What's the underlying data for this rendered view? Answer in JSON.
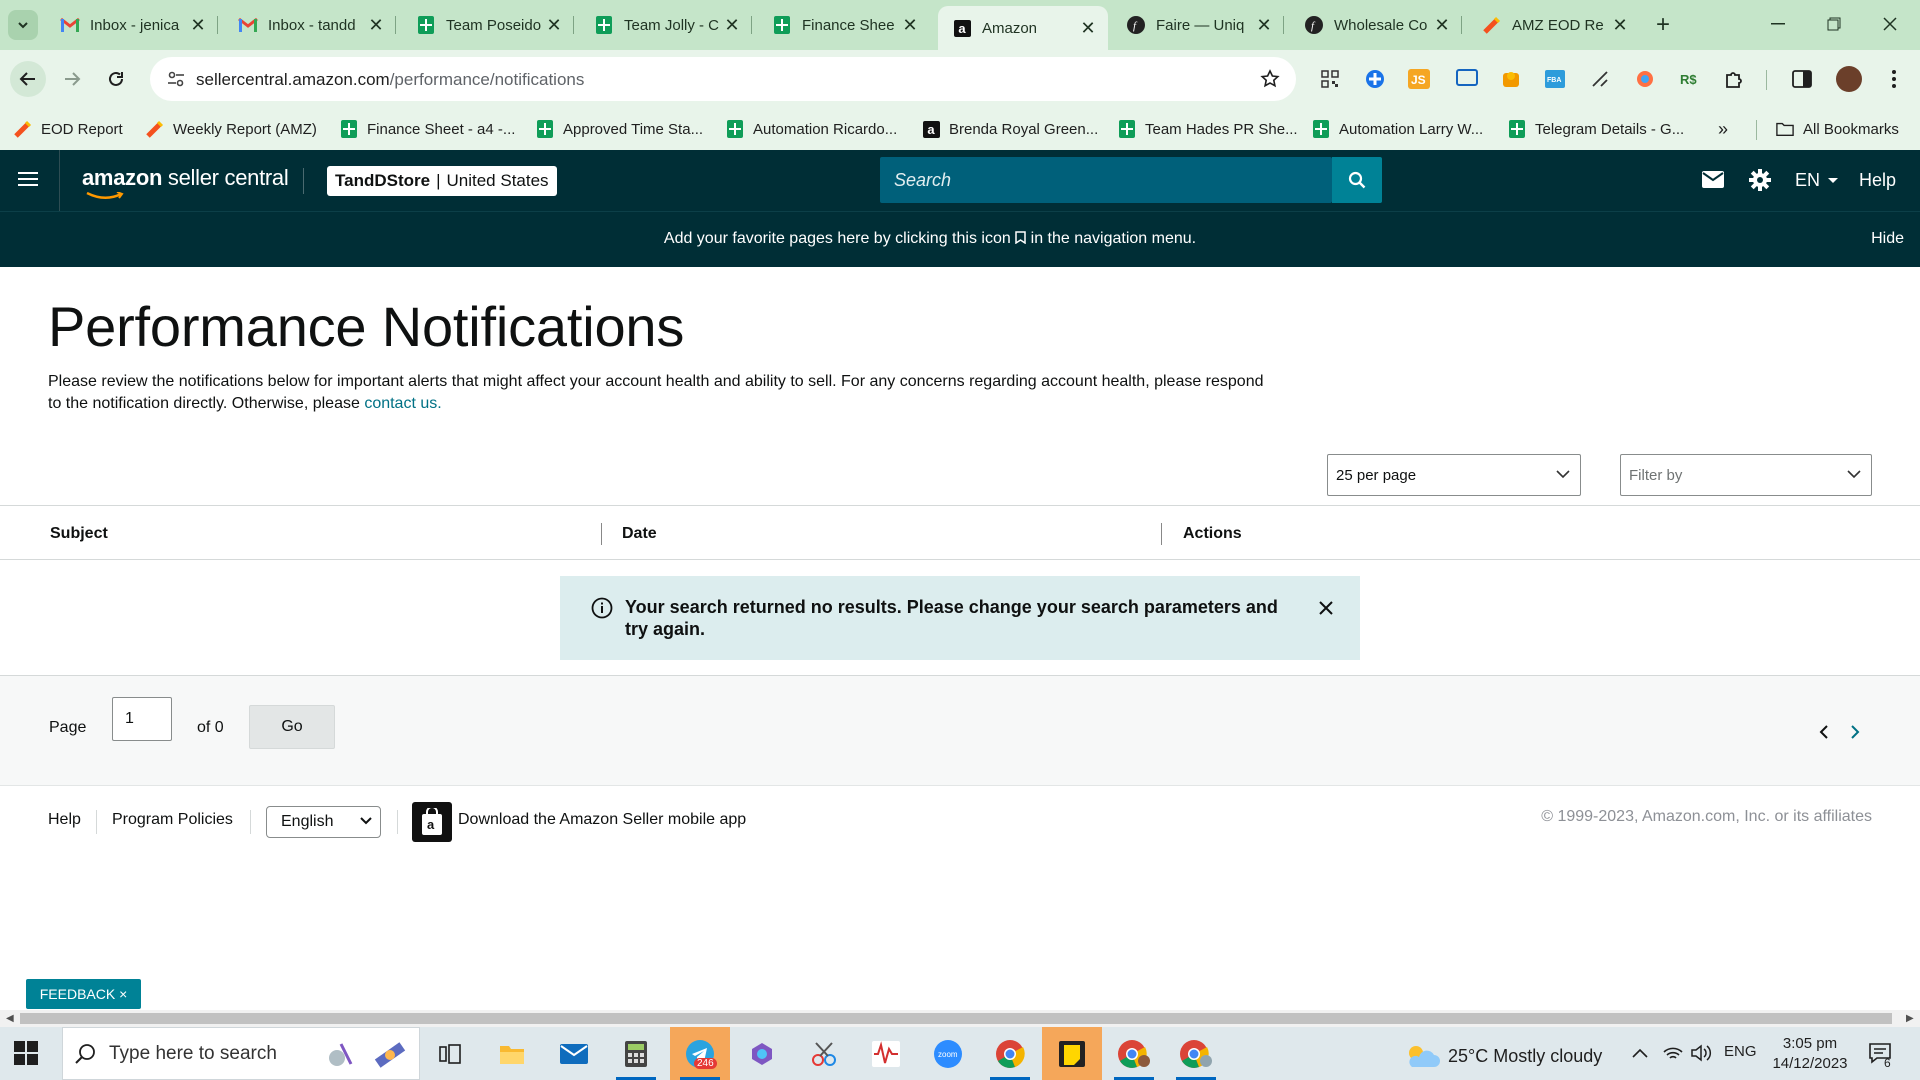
{
  "browser": {
    "tabs": [
      {
        "title": "Inbox - jenica",
        "icon": "gmail-icon"
      },
      {
        "title": "Inbox - tandd",
        "icon": "gmail-icon"
      },
      {
        "title": "Team Poseido",
        "icon": "sheets-icon"
      },
      {
        "title": "Team Jolly - C",
        "icon": "sheets-icon"
      },
      {
        "title": "Finance Shee",
        "icon": "sheets-icon"
      },
      {
        "title": "Amazon",
        "icon": "amazon-icon",
        "active": true
      },
      {
        "title": "Faire — Uniq",
        "icon": "faire-icon"
      },
      {
        "title": "Wholesale Co",
        "icon": "faire-icon"
      },
      {
        "title": "AMZ EOD Re",
        "icon": "pencil-icon"
      }
    ],
    "url_domain": "sellercentral.amazon.com",
    "url_path": "/performance/notifications",
    "extension_badge": "OK",
    "bookmarks": [
      {
        "label": "EOD Report",
        "icon": "pencil-icon"
      },
      {
        "label": "Weekly Report (AMZ)",
        "icon": "pencil-icon"
      },
      {
        "label": "Finance Sheet - a4 -...",
        "icon": "sheets-icon"
      },
      {
        "label": "Approved Time Sta...",
        "icon": "sheets-icon"
      },
      {
        "label": "Automation Ricardo...",
        "icon": "sheets-icon"
      },
      {
        "label": "Brenda Royal Green...",
        "icon": "amazon-icon"
      },
      {
        "label": "Team Hades PR She...",
        "icon": "sheets-icon"
      },
      {
        "label": "Automation Larry W...",
        "icon": "sheets-icon"
      },
      {
        "label": "Telegram Details - G...",
        "icon": "sheets-icon"
      }
    ],
    "all_bookmarks": "All Bookmarks"
  },
  "header": {
    "brand_bold": "amazon",
    "brand_rest": " seller central",
    "store_name": "TandDStore",
    "store_region": "United States",
    "search_placeholder": "Search",
    "language": "EN",
    "help": "Help"
  },
  "banner": {
    "message_before": "Add your favorite pages here by clicking this icon",
    "message_after": "in the navigation menu.",
    "hide": "Hide"
  },
  "main": {
    "title": "Performance Notifications",
    "description": "Please review the notifications below for important alerts that might affect your account health and ability to sell. For any concerns regarding account health, please respond to the notification directly. Otherwise, please ",
    "contact_link": "contact us.",
    "per_page": "25 per page",
    "filter_placeholder": "Filter by",
    "columns": [
      "Subject",
      "Date",
      "Actions"
    ],
    "alert_text": "Your search returned no results. Please change your search parameters and try again."
  },
  "pager": {
    "page_label": "Page",
    "page_value": "1",
    "of_label": "of 0",
    "go": "Go"
  },
  "footer": {
    "help": "Help",
    "program_policies": "Program Policies",
    "language": "English",
    "app_link": "Download the Amazon Seller mobile app",
    "copyright": "© 1999-2023, Amazon.com, Inc. or its affiliates"
  },
  "feedback": "FEEDBACK ×",
  "taskbar": {
    "search_placeholder": "Type here to search",
    "telegram_badge": "246",
    "weather": "25°C  Mostly cloudy",
    "language": "ENG",
    "time": "3:05 pm",
    "date": "14/12/2023",
    "notification_count": "6"
  },
  "colors": {
    "header_bg": "#002e36",
    "search_bg": "#00607a",
    "accent_teal": "#008296",
    "link": "#007185",
    "alert_bg": "#dcedee",
    "tabstrip_bg": "#c5e5c9"
  }
}
